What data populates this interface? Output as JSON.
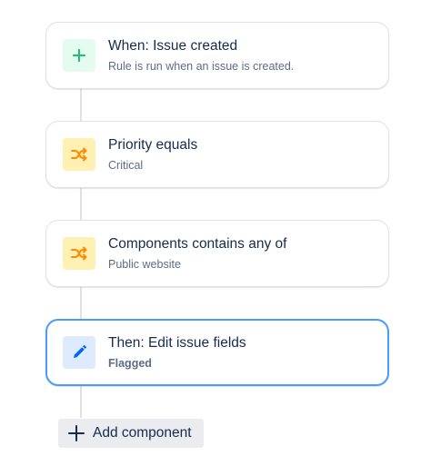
{
  "rule": {
    "steps": [
      {
        "title": "When: Issue created",
        "subtitle": "Rule is run when an issue is created.",
        "icon": "plus-icon",
        "icon_color": "#36b37e"
      },
      {
        "title": "Priority equals",
        "subtitle": "Critical",
        "icon": "shuffle-icon",
        "icon_color": "#ff8b00"
      },
      {
        "title": "Components contains any of",
        "subtitle": "Public website",
        "icon": "shuffle-icon",
        "icon_color": "#ff8b00"
      },
      {
        "title": "Then: Edit issue fields",
        "subtitle": "Flagged",
        "icon": "pencil-icon",
        "icon_color": "#0065ff",
        "selected": true
      }
    ],
    "add_component_label": "Add component"
  },
  "colors": {
    "selected_border": "#4c9aff",
    "title_text": "#172b4d",
    "subtitle_text": "#5e6c84"
  }
}
